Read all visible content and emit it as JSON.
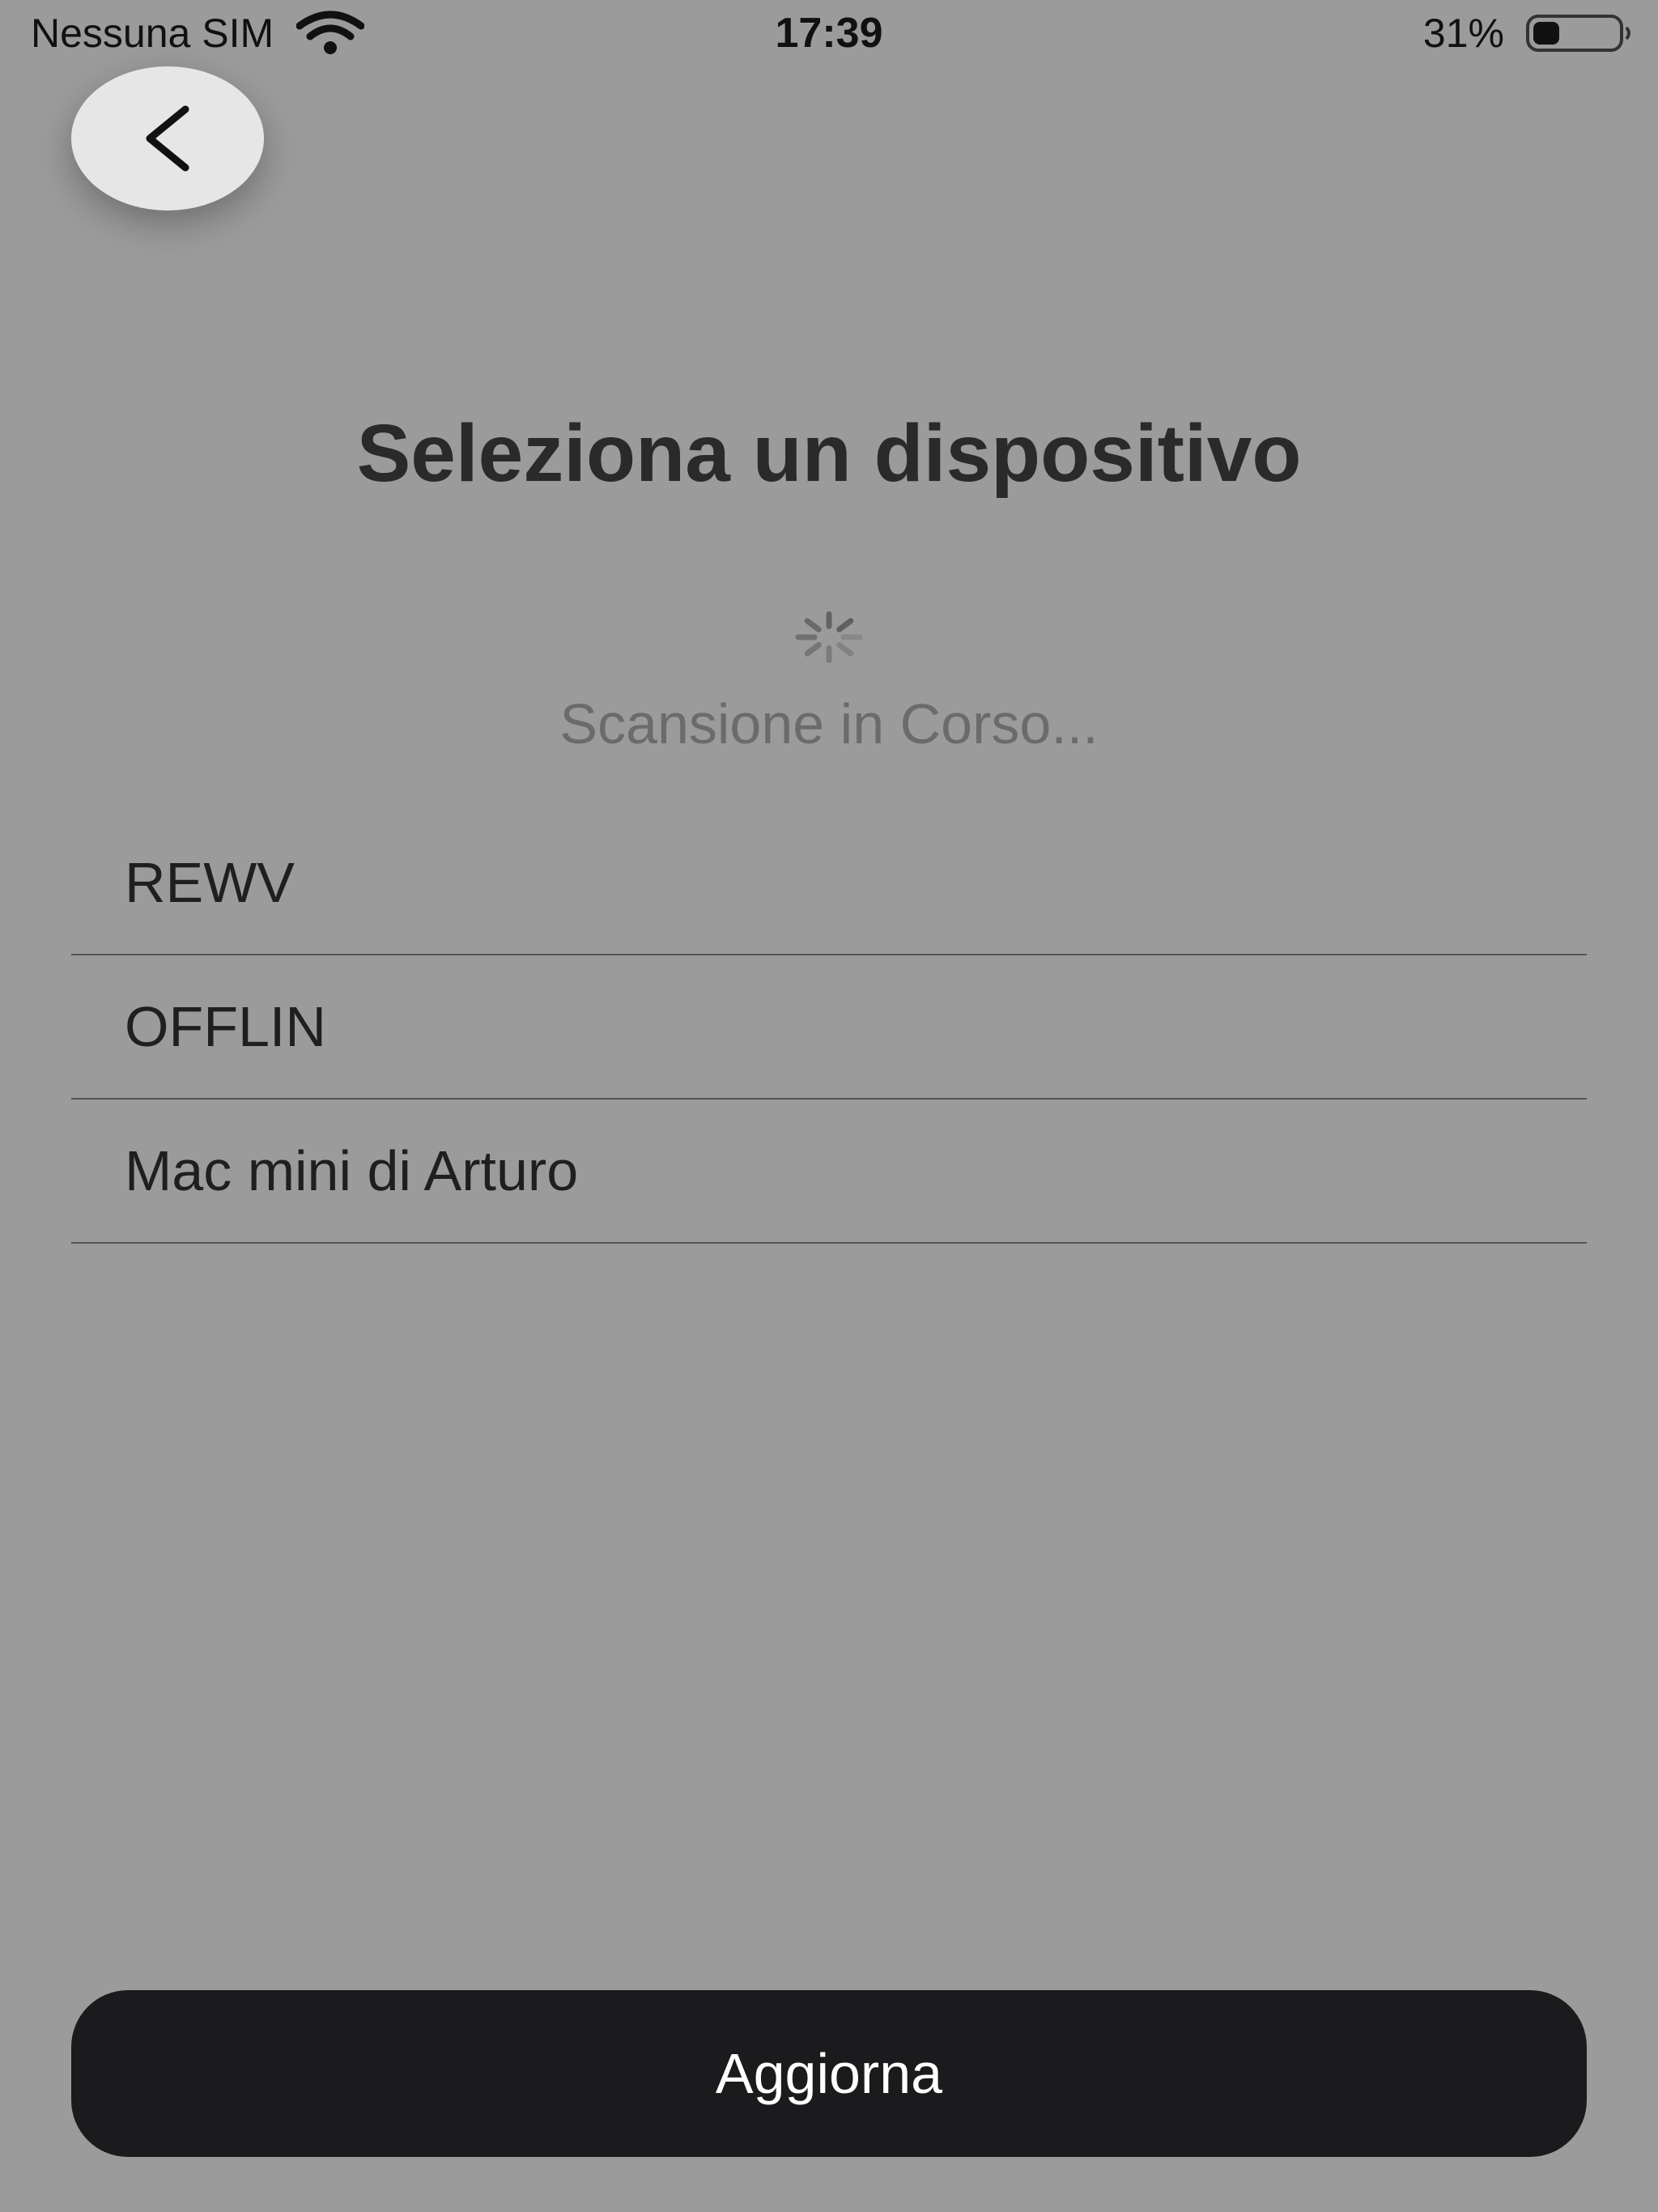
{
  "status_bar": {
    "carrier": "Nessuna SIM",
    "time": "17:39",
    "battery_percent": "31%",
    "battery_level": 0.31,
    "wifi_icon": "wifi-icon",
    "battery_icon": "battery-icon"
  },
  "navigation": {
    "back_icon": "chevron-left-icon"
  },
  "title": "Seleziona un dispositivo",
  "scan": {
    "status_text": "Scansione in Corso...",
    "spinner_icon": "spinner-icon"
  },
  "devices": [
    {
      "name": "REWV"
    },
    {
      "name": "OFFLIN"
    },
    {
      "name": "Mac mini di Arturo"
    }
  ],
  "refresh_button": {
    "label": "Aggiorna"
  },
  "colors": {
    "background": "#9b9b9b",
    "button_dark": "#1b1b1d",
    "back_button_bg": "#e6e6e6",
    "scan_text": "#6b6b6b"
  }
}
